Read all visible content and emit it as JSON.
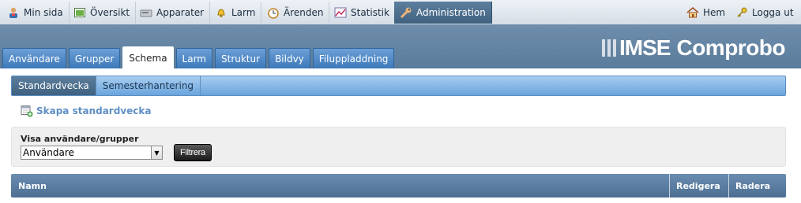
{
  "topnav": {
    "items": [
      {
        "label": "Min sida",
        "icon": "user-icon"
      },
      {
        "label": "Översikt",
        "icon": "overview-icon"
      },
      {
        "label": "Apparater",
        "icon": "device-icon"
      },
      {
        "label": "Larm",
        "icon": "alarm-bell-icon"
      },
      {
        "label": "Ärenden",
        "icon": "clock-icon"
      },
      {
        "label": "Statistik",
        "icon": "chart-icon"
      },
      {
        "label": "Administration",
        "icon": "wrench-icon",
        "active": true
      }
    ],
    "right": [
      {
        "label": "Hem",
        "icon": "home-icon"
      },
      {
        "label": "Logga ut",
        "icon": "key-icon"
      }
    ]
  },
  "logo": {
    "brand1": "IMSE",
    "brand2": "Comprobo"
  },
  "maintabs": [
    "Användare",
    "Grupper",
    "Schema",
    "Larm",
    "Struktur",
    "Bildvy",
    "Filuppladdning"
  ],
  "maintab_active": "Schema",
  "subtabs": [
    "Standardvecka",
    "Semesterhantering"
  ],
  "create_link": "Skapa standardvecka",
  "filter": {
    "label": "Visa användare/grupper",
    "selected": "Användare",
    "button": "Filtrera"
  },
  "table": {
    "headers": [
      "Namn",
      "Redigera",
      "Radera"
    ]
  }
}
